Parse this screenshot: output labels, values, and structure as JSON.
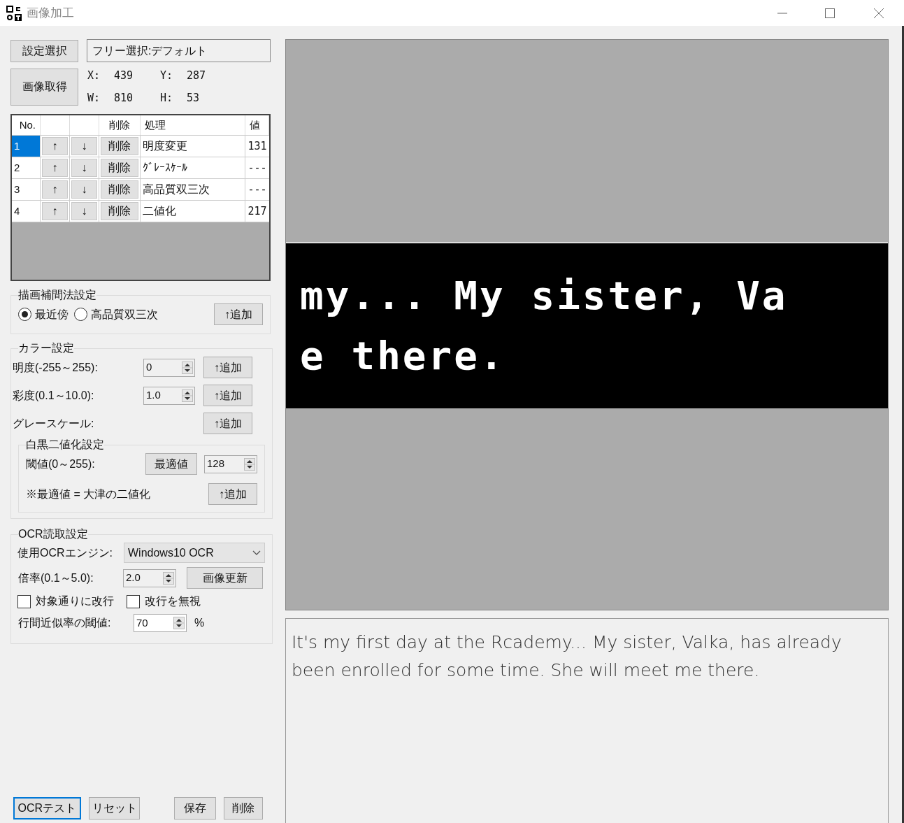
{
  "window": {
    "title": "画像加工"
  },
  "settings_button": "設定選択",
  "preset_field": {
    "value": "フリー選択:デフォルト"
  },
  "capture_button": "画像取得",
  "coords": [
    {
      "label": "X:",
      "value": "439"
    },
    {
      "label": "Y:",
      "value": "287"
    },
    {
      "label": "W:",
      "value": "810"
    },
    {
      "label": "H:",
      "value": "53"
    }
  ],
  "table": {
    "columns": [
      {
        "label": "No."
      },
      {},
      {},
      {
        "label": "削除"
      },
      {
        "label": "処理"
      },
      {
        "label": "値"
      }
    ],
    "rows": [
      {
        "no": "1",
        "up": "↑",
        "down": "↓",
        "delete": "削除",
        "process": "明度変更",
        "value": "131",
        "selected": true
      },
      {
        "no": "2",
        "up": "↑",
        "down": "↓",
        "delete": "削除",
        "process": "ｸﾞﾚｰｽｹｰﾙ",
        "value": "---",
        "selected": false
      },
      {
        "no": "3",
        "up": "↑",
        "down": "↓",
        "delete": "削除",
        "process": "高品質双三次",
        "value": "---",
        "selected": false
      },
      {
        "no": "4",
        "up": "↑",
        "down": "↓",
        "delete": "削除",
        "process": "二値化",
        "value": "217",
        "selected": false
      }
    ]
  },
  "interpolation": {
    "title": "描画補間法設定",
    "options": [
      {
        "label": "最近傍",
        "selected": true
      },
      {
        "label": "高品質双三次",
        "selected": false
      }
    ],
    "add_button": "↑追加"
  },
  "color": {
    "title": "カラー設定",
    "rows": [
      {
        "kind": "spin",
        "label": "明度(-255～255):",
        "value": "0",
        "add_button": "↑追加"
      },
      {
        "kind": "spin",
        "label": "彩度(0.1～10.0):",
        "value": "1.0",
        "add_button": "↑追加"
      },
      {
        "kind": "plain",
        "label": "グレースケール:",
        "add_button": "↑追加"
      }
    ],
    "binarize": {
      "title": "白黒二値化設定",
      "threshold_label": "閾値(0～255):",
      "optimal_button": "最適値",
      "threshold_value": "128",
      "note": "※最適値 = 大津の二値化",
      "add_button": "↑追加"
    }
  },
  "ocr": {
    "title": "OCR読取設定",
    "engine_label": "使用OCRエンジン:",
    "engine_value": "Windows10 OCR",
    "scale_label": "倍率(0.1～5.0):",
    "scale_value": "2.0",
    "refresh_button": "画像更新",
    "checkboxes": [
      {
        "label": "対象通りに改行",
        "checked": false
      },
      {
        "label": "改行を無視",
        "checked": false
      }
    ],
    "line_threshold_label": "行間近似率の閾値:",
    "line_threshold_value": "70",
    "unit": "%"
  },
  "bottom_buttons": [
    {
      "label": "OCRテスト",
      "focused": true
    },
    {
      "label": "リセット",
      "focused": false
    },
    {
      "label": "保存",
      "focused": false
    },
    {
      "label": "削除",
      "focused": false
    }
  ],
  "preview": {
    "lines": [
      "my... My sister, Va",
      "e there."
    ]
  },
  "output_text": "It's my first day at the Rcademy... My sister, Valka, has already been enrolled for some time. She will meet me there."
}
